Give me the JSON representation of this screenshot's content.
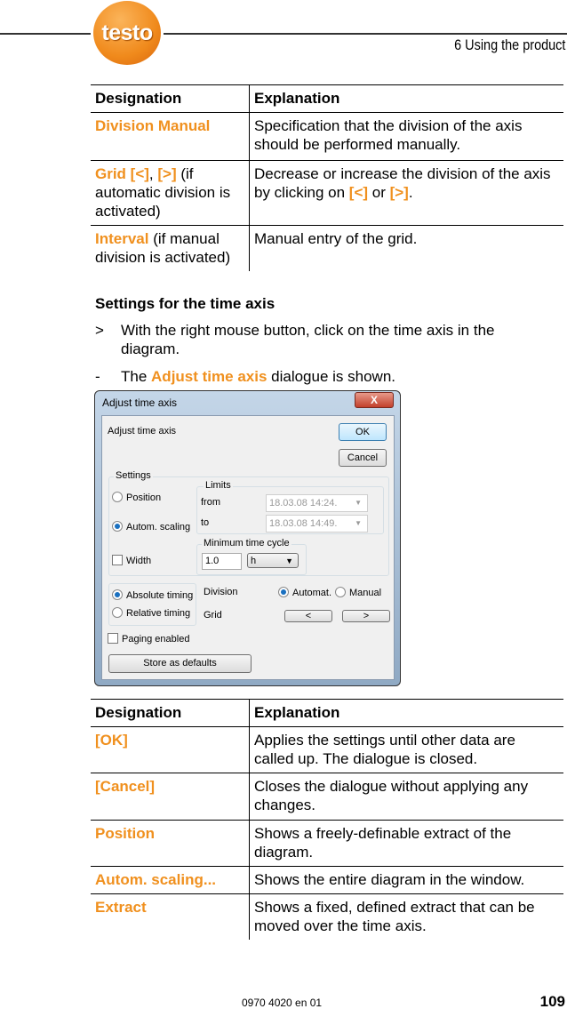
{
  "header": {
    "logo_text": "testo",
    "chapter": "6 Using the product"
  },
  "table1": {
    "headers": [
      "Designation",
      "Explanation"
    ],
    "rows": [
      {
        "term": "Division Manual",
        "note": "",
        "explanation": "Specification that the division of the axis should be performed manually."
      },
      {
        "term_parts": [
          "Grid [<]",
          ", ",
          "[>]"
        ],
        "note": " (if automatic division is activated)",
        "explanation_pre": "Decrease or increase the division of the axis by clicking on ",
        "explanation_k1": "[<]",
        "explanation_mid": " or ",
        "explanation_k2": "[>]",
        "explanation_post": "."
      },
      {
        "term": "Interval",
        "note": " (if manual division is activated)",
        "explanation": "Manual entry of the grid."
      }
    ]
  },
  "section": {
    "title": "Settings for the time axis",
    "step_marker": ">",
    "step": "With the right mouse button, click on the time axis in the diagram.",
    "result_marker": "-",
    "result_pre": "The ",
    "result_key": "Adjust time axis",
    "result_post": " dialogue is shown."
  },
  "dialog": {
    "title": "Adjust time axis",
    "close": "X",
    "heading": "Adjust time axis",
    "ok": "OK",
    "cancel": "Cancel",
    "settings_legend": "Settings",
    "position": "Position",
    "autom_scaling": "Autom. scaling",
    "width": "Width",
    "limits_legend": "Limits",
    "from_label": "from",
    "from_value": "18.03.08  14:24.",
    "to_label": "to",
    "to_value": "18.03.08  14:49.",
    "min_cycle_legend": "Minimum time cycle",
    "min_cycle_value": "1.0",
    "min_cycle_unit": "h",
    "absolute_timing": "Absolute timing",
    "relative_timing": "Relative timing",
    "division_label": "Division",
    "automat": "Automat.",
    "manual": "Manual",
    "grid_label": "Grid",
    "grid_dec": "<",
    "grid_inc": ">",
    "paging": "Paging enabled",
    "store_defaults": "Store as defaults"
  },
  "table2": {
    "headers": [
      "Designation",
      "Explanation"
    ],
    "rows": [
      {
        "term": "[OK]",
        "explanation": "Applies the settings until other data are called up. The dialogue is closed."
      },
      {
        "term": "[Cancel]",
        "explanation": "Closes the dialogue without applying any changes."
      },
      {
        "term": "Position",
        "explanation": "Shows a freely-definable extract of the diagram."
      },
      {
        "term": "Autom. scaling...",
        "explanation": "Shows the entire diagram in the window."
      },
      {
        "term": "Extract",
        "explanation": "Shows a fixed, defined extract that can be moved over the time axis."
      }
    ]
  },
  "footer": {
    "doc_number": "0970 4020 en 01",
    "page_number": "109"
  }
}
